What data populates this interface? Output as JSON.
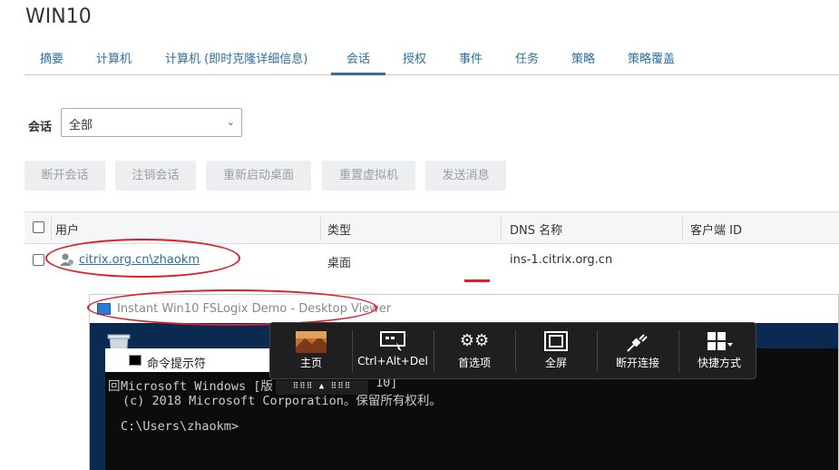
{
  "page": {
    "title": "WIN10"
  },
  "tabs": [
    {
      "label": "摘要"
    },
    {
      "label": "计算机"
    },
    {
      "label": "计算机 (即时克隆详细信息)"
    },
    {
      "label": "会话"
    },
    {
      "label": "授权"
    },
    {
      "label": "事件"
    },
    {
      "label": "任务"
    },
    {
      "label": "策略"
    },
    {
      "label": "策略覆盖"
    }
  ],
  "active_tab": "会话",
  "filter": {
    "label": "会话",
    "value": "全部"
  },
  "actions": [
    {
      "label": "断开会话"
    },
    {
      "label": "注销会话"
    },
    {
      "label": "重新启动桌面"
    },
    {
      "label": "重置虚拟机"
    },
    {
      "label": "发送消息"
    }
  ],
  "grid": {
    "columns": [
      "用户",
      "类型",
      "DNS 名称",
      "客户端 ID"
    ],
    "rows": [
      {
        "user": "citrix.org.cn\\zhaokm",
        "type": "桌面",
        "dns": "ins-1.citrix.org.cn",
        "client_id": ""
      }
    ]
  },
  "viewer": {
    "title": "Instant Win10 FSLogix Demo - Desktop Viewer",
    "cmd_title": "命令提示符",
    "lines": [
      "Microsoft Windows [版",
      "(c) 2018 Microsoft Corporation。保留所有权利。",
      "",
      "C:\\Users\\zhaokm>"
    ],
    "line1_tail": "10]"
  },
  "toolbar": {
    "items": [
      {
        "label": "主页",
        "icon": "home-thumbnail-icon"
      },
      {
        "label": "Ctrl+Alt+Del",
        "icon": "ctrl-alt-del-icon"
      },
      {
        "label": "首选项",
        "icon": "gears-icon"
      },
      {
        "label": "全屏",
        "icon": "fullscreen-icon"
      },
      {
        "label": "断开连接",
        "icon": "disconnect-plug-icon"
      },
      {
        "label": "快捷方式",
        "icon": "shortcuts-grid-icon"
      }
    ]
  },
  "colors": {
    "link": "#2d6f9e",
    "annotation": "#d9212c",
    "toolbar_bg": "#1f1f1f",
    "desktop_bg": "#0b2a52"
  }
}
